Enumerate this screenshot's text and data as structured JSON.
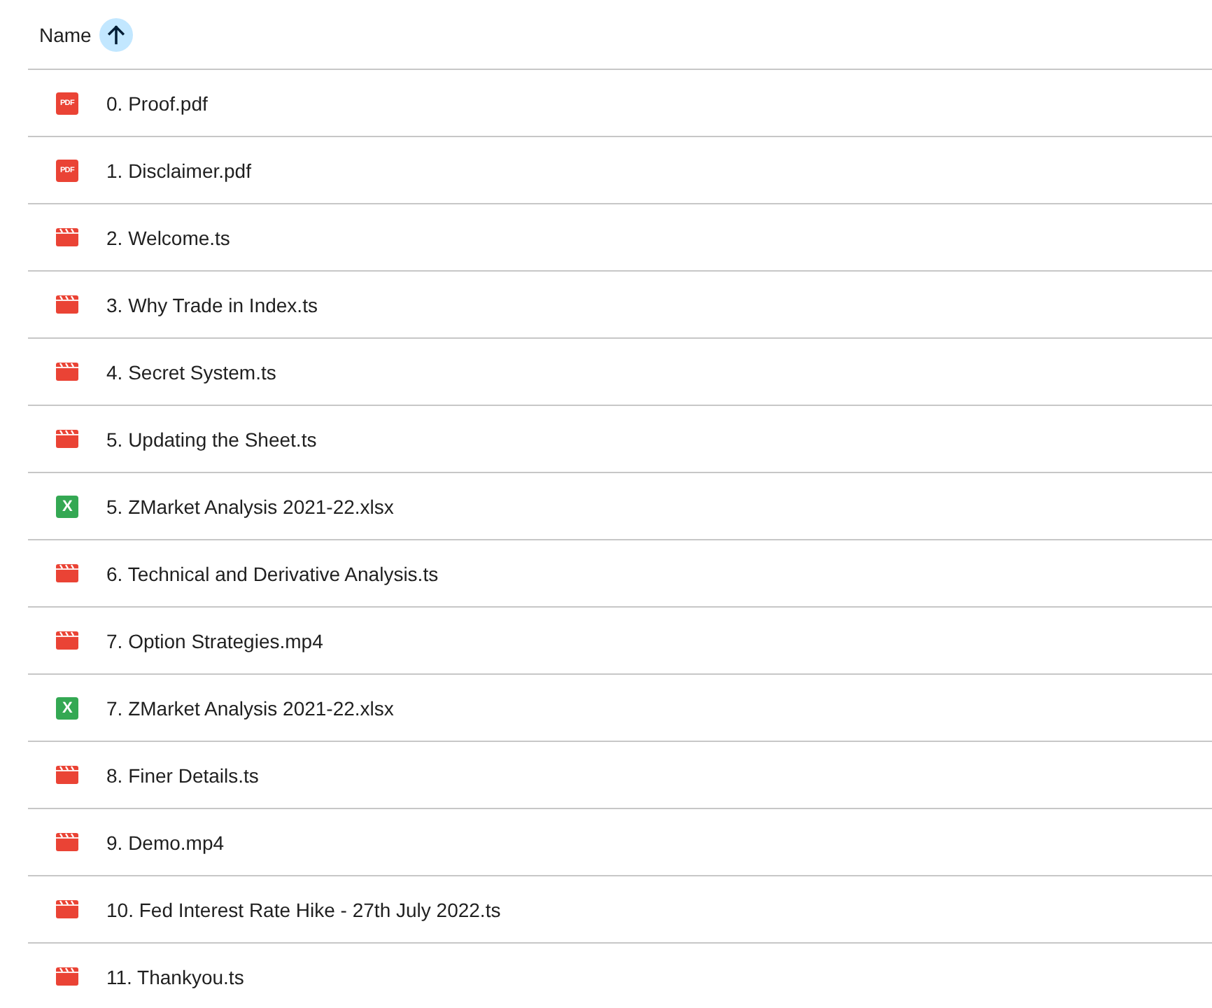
{
  "header": {
    "label": "Name",
    "ascending": true
  },
  "files": [
    {
      "kind": "pdf",
      "icon_text": "PDF",
      "name": "0. Proof.pdf"
    },
    {
      "kind": "pdf",
      "icon_text": "PDF",
      "name": "1. Disclaimer.pdf"
    },
    {
      "kind": "video",
      "name": "2. Welcome.ts"
    },
    {
      "kind": "video",
      "name": "3. Why Trade in Index.ts"
    },
    {
      "kind": "video",
      "name": "4. Secret System.ts"
    },
    {
      "kind": "video",
      "name": "5. Updating the Sheet.ts"
    },
    {
      "kind": "sheet",
      "icon_text": "X",
      "name": "5. ZMarket Analysis 2021-22.xlsx"
    },
    {
      "kind": "video",
      "name": "6. Technical and Derivative Analysis.ts"
    },
    {
      "kind": "video",
      "name": "7. Option Strategies.mp4"
    },
    {
      "kind": "sheet",
      "icon_text": "X",
      "name": "7. ZMarket Analysis 2021-22.xlsx"
    },
    {
      "kind": "video",
      "name": "8. Finer Details.ts"
    },
    {
      "kind": "video",
      "name": "9. Demo.mp4"
    },
    {
      "kind": "video",
      "name": "10. Fed Interest Rate Hike - 27th July 2022.ts"
    },
    {
      "kind": "video",
      "name": "11. Thankyou.ts"
    }
  ]
}
